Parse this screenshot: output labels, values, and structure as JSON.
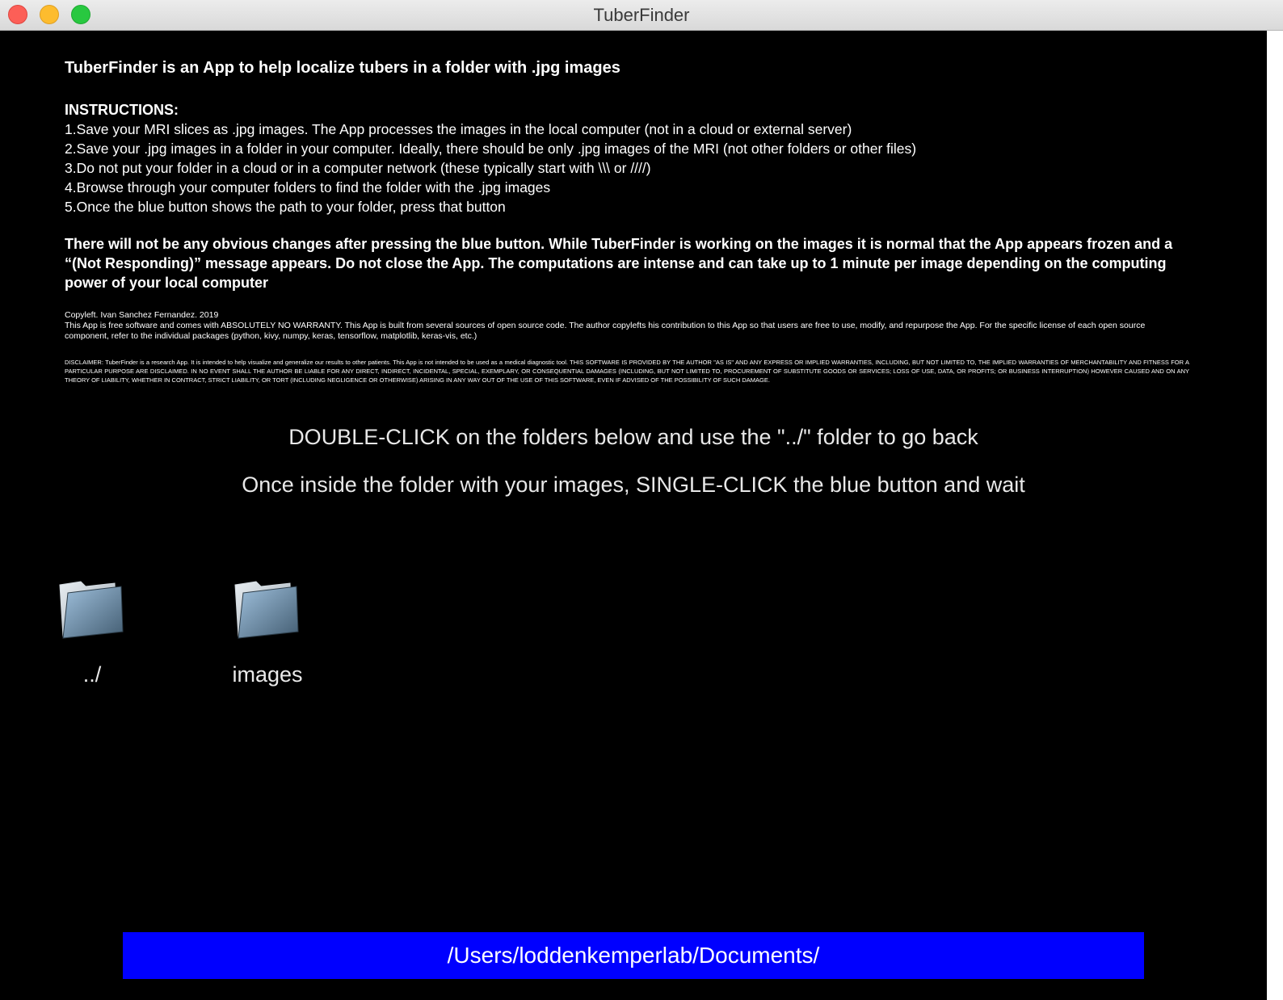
{
  "window": {
    "title": "TuberFinder"
  },
  "info": {
    "heading": "TuberFinder is an App to help localize tubers in a folder with .jpg images",
    "instructions_title": "INSTRUCTIONS:",
    "steps": [
      "1.Save your MRI slices as .jpg images. The App processes the images in the local computer (not in a cloud or external server)",
      "2.Save your .jpg images in a folder in your computer. Ideally, there should be only .jpg images of the MRI (not other folders or other files)",
      "3.Do not put your folder in a cloud or in a computer network (these typically start with \\\\\\ or ////)",
      "4.Browse through your computer folders to find the folder with the .jpg images",
      "5.Once the blue button shows the path to your folder, press that button"
    ],
    "warning": "There will not be any obvious changes after pressing the blue button. While TuberFinder is working on the images it is normal that the App appears frozen and a “(Not Responding)” message appears. Do not close the App. The computations are intense and can take up to 1 minute per image depending on the computing power of your local computer",
    "copyright": "Copyleft. Ivan Sanchez Fernandez. 2019",
    "license": "This App is free software and comes with ABSOLUTELY NO WARRANTY. This App is built from several sources of open source code. The author copylefts his contribution to this App so that users are free to use, modify, and repurpose the App. For the specific license of each open source component, refer to the individual packages (python, kivy, numpy, keras, tensorflow, matplotlib, keras-vis, etc.)",
    "disclaimer": "DISCLAIMER: TuberFinder is a research App. It is intended to help visualize and generalize our results to other patients. This App is not intended to be used as a medical diagnostic tool. THIS SOFTWARE IS PROVIDED BY THE AUTHOR \"AS IS\" AND ANY EXPRESS OR IMPLIED WARRANTIES, INCLUDING, BUT NOT LIMITED TO, THE IMPLIED WARRANTIES OF MERCHANTABILITY AND FITNESS FOR A PARTICULAR PURPOSE ARE DISCLAIMED. IN NO EVENT SHALL THE AUTHOR BE LIABLE FOR ANY DIRECT, INDIRECT, INCIDENTAL, SPECIAL, EXEMPLARY, OR CONSEQUENTIAL DAMAGES (INCLUDING, BUT NOT LIMITED TO, PROCUREMENT OF SUBSTITUTE GOODS OR SERVICES; LOSS OF USE, DATA, OR PROFITS; OR BUSINESS INTERRUPTION) HOWEVER CAUSED AND ON ANY THEORY OF LIABILITY, WHETHER IN CONTRACT, STRICT LIABILITY, OR TORT (INCLUDING NEGLIGENCE OR OTHERWISE) ARISING IN ANY WAY OUT OF THE USE OF THIS SOFTWARE, EVEN IF ADVISED OF THE POSSIBILITY OF SUCH DAMAGE."
  },
  "prompts": {
    "double_click": "DOUBLE-CLICK on the folders below and use the \"../\" folder to go back",
    "single_click": "Once inside the folder with your images, SINGLE-CLICK the blue button and wait"
  },
  "folders": [
    {
      "label": "../",
      "icon": "folder-icon"
    },
    {
      "label": "images",
      "icon": "folder-icon"
    }
  ],
  "path_button": {
    "label": "/Users/loddenkemperlab/Documents/",
    "color": "#0000ff"
  }
}
